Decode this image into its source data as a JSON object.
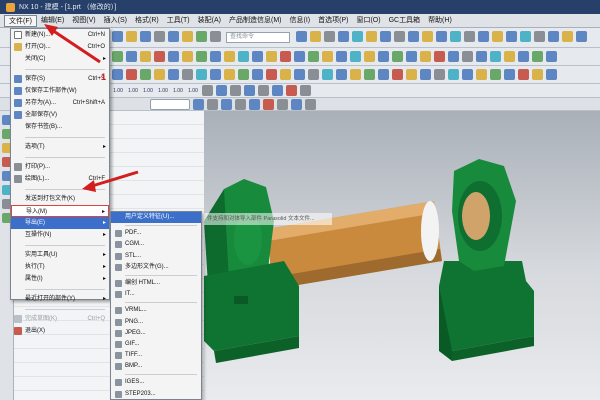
{
  "window": {
    "title": "NX 10 - 建模 - [1.prt （修改的）]"
  },
  "menubar": {
    "items": [
      "文件(F)",
      "编辑(E)",
      "视图(V)",
      "插入(S)",
      "格式(R)",
      "工具(T)",
      "装配(A)",
      "产品制造信息(M)",
      "信息(I)",
      "首选项(P)",
      "窗口(O)",
      "GC工具箱",
      "帮助(H)"
    ]
  },
  "toolbar": {
    "search_placeholder": "查找命令",
    "precision_buttons": [
      "1.00",
      "1.00",
      "1.00",
      "1.00",
      "1.00",
      "1.00"
    ]
  },
  "file_menu": {
    "items": [
      {
        "label": "新建(N)...",
        "shortcut": "Ctrl+N"
      },
      {
        "label": "打开(O)...",
        "shortcut": "Ctrl+O"
      },
      {
        "label": "关闭(C)",
        "arrow": "▸"
      },
      {
        "label": "保存(S)",
        "shortcut": "Ctrl+S"
      },
      {
        "label": "仅保存工作部件(W)"
      },
      {
        "label": "另存为(A)...",
        "shortcut": "Ctrl+Shift+A"
      },
      {
        "label": "全部保存(V)"
      },
      {
        "label": "保存书签(B)..."
      },
      {
        "label": "选项(T)",
        "arrow": "▸"
      },
      {
        "label": "打印(P)..."
      },
      {
        "label": "绘图(L)...",
        "shortcut": "Ctrl+F"
      },
      {
        "label": "发送到打包文件(K)"
      },
      {
        "label": "导入(M)",
        "arrow": "▸"
      },
      {
        "label": "导出(E)",
        "arrow": "▸"
      },
      {
        "label": "互操作(N)",
        "arrow": "▸"
      },
      {
        "label": "实用工具(U)",
        "arrow": "▸"
      },
      {
        "label": "执行(T)",
        "arrow": "▸"
      },
      {
        "label": "属性(I)",
        "arrow": "▸"
      },
      {
        "label": "最近打开的部件(Y)",
        "arrow": "▸"
      },
      {
        "label": "完成草图(K)",
        "shortcut": "Ctrl+Q"
      },
      {
        "label": "退出(X)"
      }
    ]
  },
  "import_submenu": {
    "items": [
      "用户定义特征(U)...",
      "PDF...",
      "CGM...",
      "STL...",
      "多边形文件(G)...",
      "编创 HTML...",
      "IT...",
      "VRML...",
      "PNG...",
      "JPEG...",
      "GIF...",
      "TIFF...",
      "BMP...",
      "IGES...",
      "STEP203..."
    ]
  },
  "tooltip": {
    "text": "件支持和对体导入部件 Parasolid 文本文件..."
  },
  "annotation": {
    "number": "1"
  },
  "colors": {
    "accent": "#3b6fc9",
    "highlight_border": "#dd4444",
    "annotation_red": "#d21e1e",
    "model_green": "#16853a",
    "model_shaft": "#c98a3e"
  }
}
